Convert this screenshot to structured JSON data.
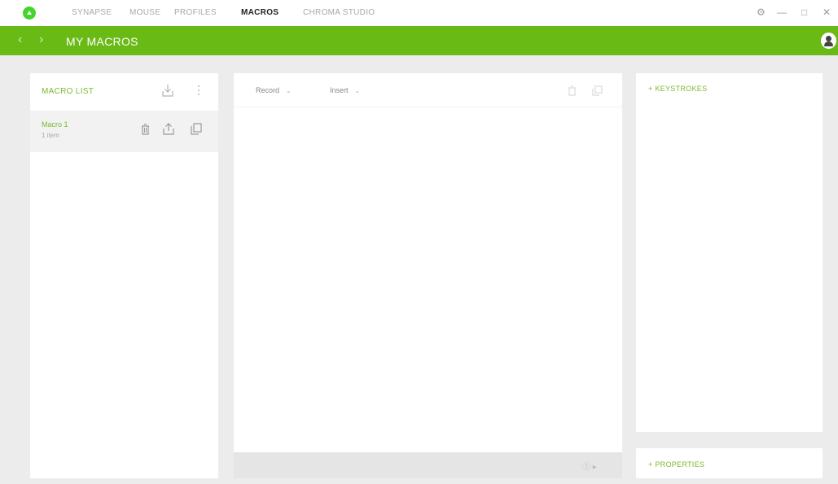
{
  "nav": {
    "tabs": [
      {
        "label": "SYNAPSE"
      },
      {
        "label": "MOUSE"
      },
      {
        "label": "PROFILES"
      },
      {
        "label": "MACROS"
      },
      {
        "label": "CHROMA STUDIO"
      }
    ],
    "window_controls": {
      "settings": "⚙",
      "minimize": "—",
      "maximize": "□",
      "close": "✕"
    }
  },
  "header": {
    "back": "‹",
    "forward": "›",
    "title": "MY MACROS"
  },
  "left_panel": {
    "title": "MACRO LIST",
    "items": [
      {
        "name": "Macro 1",
        "detail": "1 item"
      }
    ]
  },
  "center_panel": {
    "record_label": "Record",
    "insert_label": "Insert",
    "footer_control": "Ⓘ ▸"
  },
  "right_panel": {
    "keystrokes_title": "+ KEYSTROKES",
    "properties_title": "+ PROPERTIES"
  },
  "colors": {
    "accent": "#6aba15",
    "accent_text": "#7cb82f",
    "background": "#ececec"
  }
}
